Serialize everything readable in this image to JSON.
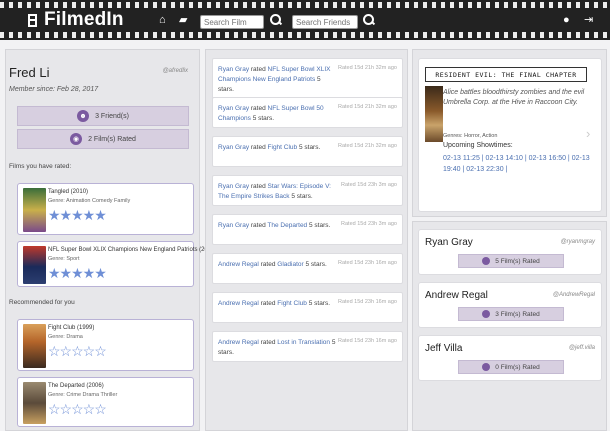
{
  "navbar": {
    "brand": "FilmedIn",
    "search_film_placeholder": "Search Film",
    "search_friends_placeholder": "Search Friends"
  },
  "profile": {
    "name": "Fred Li",
    "handle": "@afredlix",
    "member_since": "Member since: Feb 28, 2017",
    "friends_label": "3 Friend(s)",
    "rated_label": "2 Film(s) Rated",
    "films_rated_heading": "Films you have rated:",
    "rated_films": [
      {
        "title": "Tangled (2010)",
        "genre": "Genre: Animation Comedy Family",
        "stars": 5
      },
      {
        "title": "NFL Super Bowl XLIX Champions New England Patriots (2015)",
        "genre": "Genre: Sport",
        "stars": 5
      }
    ],
    "recommended_heading": "Recommended for you",
    "recommended_films": [
      {
        "title": "Fight Club (1999)",
        "genre": "Genre: Drama",
        "stars": 0
      },
      {
        "title": "The Departed (2006)",
        "genre": "Genre: Crime Drama Thriller",
        "stars": 0
      }
    ]
  },
  "feed": [
    {
      "who": "Ryan Gray",
      "verb": "rated",
      "what": "NFL Super Bowl XLIX Champions New England Patriots",
      "rating": "5 stars.",
      "time": "Rated 15d 21h 32m ago"
    },
    {
      "who": "Ryan Gray",
      "verb": "rated",
      "what": "NFL Super Bowl 50 Champions",
      "rating": "5 stars.",
      "time": "Rated 15d 21h 32m ago"
    },
    {
      "who": "Ryan Gray",
      "verb": "rated",
      "what": "Fight Club",
      "rating": "5 stars.",
      "time": "Rated 15d 21h 32m ago"
    },
    {
      "who": "Ryan Gray",
      "verb": "rated",
      "what": "Star Wars: Episode V: The Empire Strikes Back",
      "rating": "5 stars.",
      "time": "Rated 15d 23h 3m ago"
    },
    {
      "who": "Ryan Gray",
      "verb": "rated",
      "what": "The Departed",
      "rating": "5 stars.",
      "time": "Rated 15d 23h 3m ago"
    },
    {
      "who": "Andrew Regal",
      "verb": "rated",
      "what": "Gladiator",
      "rating": "5 stars.",
      "time": "Rated 15d 23h 16m ago"
    },
    {
      "who": "Andrew Regal",
      "verb": "rated",
      "what": "Fight Club",
      "rating": "5 stars.",
      "time": "Rated 15d 23h 16m ago"
    },
    {
      "who": "Andrew Regal",
      "verb": "rated",
      "what": "Lost in Translation",
      "rating": "5 stars.",
      "time": "Rated 15d 23h 16m ago"
    }
  ],
  "showtimes": {
    "movie_title": "RESIDENT EVIL: THE FINAL CHAPTER",
    "description": "Alice battles bloodthirsty zombies and the evil Umbrella Corp. at the Hive in Raccoon City.",
    "genres": "Genres: Horror, Action",
    "label": "Upcoming Showtimes:",
    "times": "02-13 11:25 | 02-13 14:10 | 02-13 16:50 | 02-13 19:40 | 02-13 22:30 |"
  },
  "friends": [
    {
      "name": "Ryan Gray",
      "handle": "@ryanmgray",
      "rated": "5 Film(s) Rated"
    },
    {
      "name": "Andrew Regal",
      "handle": "@AndrewRegal",
      "rated": "3 Film(s) Rated"
    },
    {
      "name": "Jeff Villa",
      "handle": "@jeff.villa",
      "rated": "0 Film(s) Rated"
    }
  ],
  "colors": {
    "navbar": "#222222",
    "accent_link": "#4a6fb0",
    "button_purple": "#d7cfe0",
    "star_blue": "#6f8fd6"
  },
  "icons": [
    "film-icon",
    "home-icon",
    "chat-icon",
    "search-icon",
    "user-icon",
    "logout-icon",
    "users-icon",
    "film-reel-icon",
    "chevron-right-icon"
  ]
}
